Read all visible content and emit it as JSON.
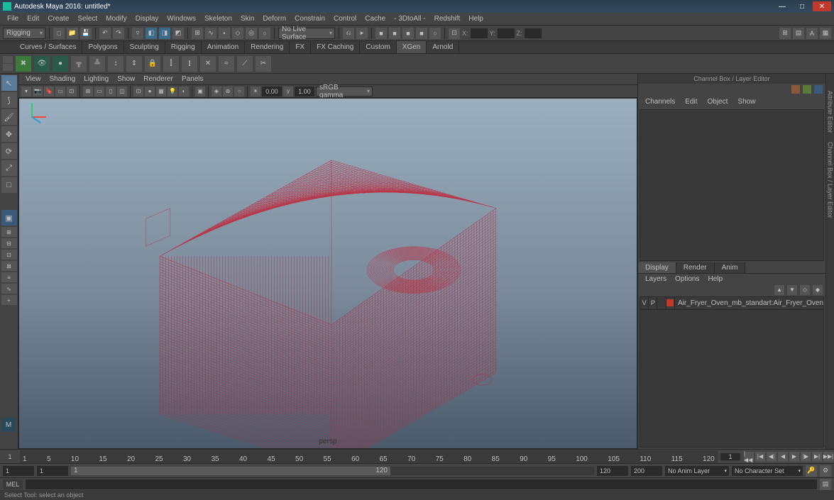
{
  "title": "Autodesk Maya 2016: untitled*",
  "menu": [
    "File",
    "Edit",
    "Create",
    "Select",
    "Modify",
    "Display",
    "Windows",
    "Skeleton",
    "Skin",
    "Deform",
    "Constrain",
    "Control",
    "Cache",
    "- 3DtoAll -",
    "Redshift",
    "Help"
  ],
  "workspace": "Rigging",
  "liveSurface": "No Live Surface",
  "coords": {
    "x": "X:",
    "y": "Y:",
    "z": "Z:"
  },
  "shelfTabs": [
    "Curves / Surfaces",
    "Polygons",
    "Sculpting",
    "Rigging",
    "Animation",
    "Rendering",
    "FX",
    "FX Caching",
    "Custom",
    "XGen",
    "Arnold"
  ],
  "shelfActive": "XGen",
  "panelMenu": [
    "View",
    "Shading",
    "Lighting",
    "Show",
    "Renderer",
    "Panels"
  ],
  "expVal1": "0.00",
  "expVal2": "1.00",
  "colorspace": "sRGB gamma",
  "perspLabel": "persp",
  "channelBox": {
    "title": "Channel Box / Layer Editor",
    "menu": [
      "Channels",
      "Edit",
      "Object",
      "Show"
    ]
  },
  "layerTabs": [
    "Display",
    "Render",
    "Anim"
  ],
  "layerActive": "Display",
  "layerMenu": [
    "Layers",
    "Options",
    "Help"
  ],
  "layer": {
    "v": "V",
    "p": "P",
    "name": "Air_Fryer_Oven_mb_standart:Air_Fryer_Oven"
  },
  "ticks": [
    "1",
    "5",
    "10",
    "15",
    "20",
    "25",
    "30",
    "35",
    "40",
    "45",
    "50",
    "55",
    "60",
    "65",
    "70",
    "75",
    "80",
    "85",
    "90",
    "95",
    "100",
    "105",
    "110",
    "115",
    "120"
  ],
  "currentFrame": "1",
  "range": {
    "startOut": "1",
    "startIn": "1",
    "endIn": "120",
    "endOut": "120",
    "end2": "200"
  },
  "animLayer": "No Anim Layer",
  "charSet": "No Character Set",
  "mel": "MEL",
  "status": "Select Tool: select an object",
  "sideTabs": [
    "Attribute Editor",
    "Channel Box / Layer Editor"
  ]
}
